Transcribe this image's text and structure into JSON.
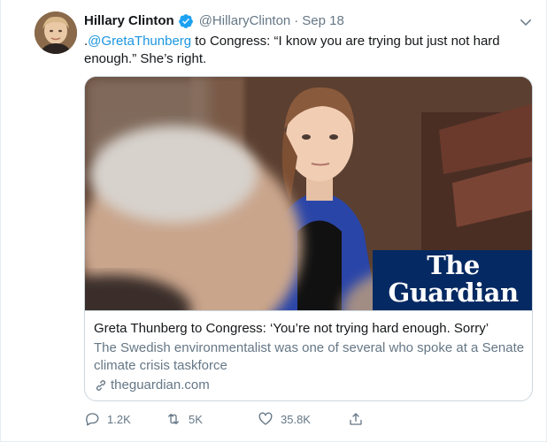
{
  "tweet": {
    "author_name": "Hillary Clinton",
    "handle": "@HillaryClinton",
    "separator": "·",
    "date": "Sep 18",
    "text_prefix": ".",
    "mention": "@GretaThunberg",
    "text_body": " to Congress: “I know you are trying but just not hard enough.” She’s right."
  },
  "card": {
    "logo_line1": "The",
    "logo_line2": "Guardian",
    "title": "Greta Thunberg to Congress: ‘You’re not trying hard enough. Sorry’",
    "description": "The Swedish environmentalist was one of several who spoke at a Senate climate crisis taskforce",
    "domain": "theguardian.com"
  },
  "actions": {
    "replies": "1.2K",
    "retweets": "5K",
    "likes": "35.8K"
  },
  "icons": {
    "verified": "verified-badge-icon",
    "caret": "chevron-down-icon",
    "link": "link-icon",
    "reply": "reply-icon",
    "retweet": "retweet-icon",
    "like": "heart-icon",
    "share": "share-icon"
  },
  "colors": {
    "accent": "#1b95e0",
    "secondary_text": "#657786",
    "guardian_blue": "#052962"
  }
}
